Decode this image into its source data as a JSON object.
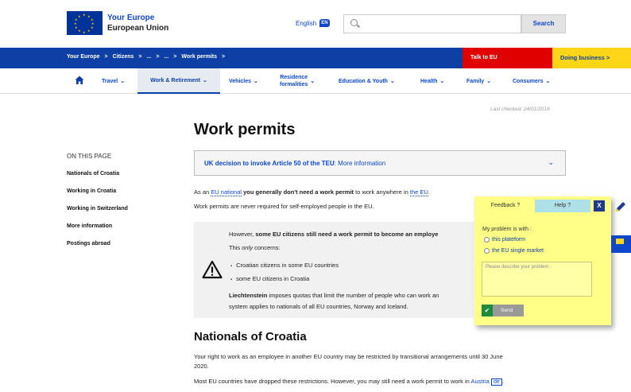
{
  "header": {
    "brand_line1": "Your Europe",
    "brand_line2": "European Union",
    "language": "English",
    "language_code": "EN",
    "search_placeholder": "",
    "search_button": "Search"
  },
  "breadcrumb": {
    "items": [
      "Your Europe",
      ">",
      "Citizens",
      ">",
      "...",
      ">",
      "...",
      ">",
      "Work permits",
      ">"
    ],
    "talk_to_eu": "Talk to EU",
    "doing_business": "Doing business  >"
  },
  "nav": {
    "items": [
      {
        "label": "Travel"
      },
      {
        "label": "Work & Retirement"
      },
      {
        "label": "Vehicles"
      },
      {
        "label": "Residence formalities"
      },
      {
        "label": "Education & Youth"
      },
      {
        "label": "Health"
      },
      {
        "label": "Family"
      },
      {
        "label": "Consumers"
      }
    ],
    "residence_line1": "Residence",
    "residence_line2": "formalities"
  },
  "page": {
    "last_checked": "Last checked: 24/01/2019",
    "title": "Work permits",
    "on_this_page": "ON THIS PAGE",
    "toc": [
      "Nationals of Croatia",
      "Working in Croatia",
      "Working in Switzerland",
      "More information",
      "Postings abroad"
    ],
    "notice_bold": "UK decision to invoke Article 50 of the TEU",
    "notice_rest": ": More information",
    "para1_a": "As an ",
    "para1_link1": "EU national",
    "para1_b": " you generally don't need a work permit",
    "para1_c": " to work anywhere in ",
    "para1_link2": "the EU",
    "para1_d": ".",
    "para2": "Work permits are never required for self-employed people in the EU.",
    "info_line1_a": "However, ",
    "info_line1_b": "some EU citizens still need a work permit to become an employe",
    "info_line2_a": "This ",
    "info_line2_b": "only",
    "info_line2_c": " concerns:",
    "info_bullet1": "Croatian citizens in some EU countries",
    "info_bullet2": "some EU citizens in Croatia",
    "info_line3_a": "Liechtenstein",
    "info_line3_b": " imposes quotas that limit the number of people who can work an",
    "info_line4": "system applies to nationals of all EU countries, Norway and Iceland.",
    "h2": "Nationals of Croatia",
    "para3_line1": "Your right to work as an employee in another EU country may be restricted by transitional arrangements until 30 June",
    "para3_line2": "2020.",
    "para4_a": "Most EU countries have dropped these restrictions. However, you may still need a work permit to work in ",
    "para4_link": "Austria",
    "para4_badge": "de",
    "para4_end": "."
  },
  "feedback": {
    "tab_feedback": "Feedback ?",
    "tab_help": "Help ?",
    "close": "X",
    "problem_label": "My problem is with :",
    "option1": "this plateform",
    "option2": "the EU single market",
    "textarea_placeholder": "Please describe your problem :",
    "send": "Send"
  },
  "colors": {
    "eu_blue": "#0e3fa5",
    "link_blue": "#0e47cb",
    "talk_red": "#e00000",
    "doing_yellow": "#ffd617",
    "feedback_yellow": "#ffff88"
  }
}
